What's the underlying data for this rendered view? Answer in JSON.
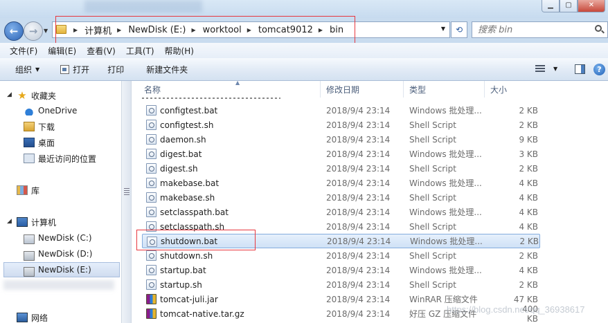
{
  "window": {
    "minimize_label": "▁",
    "maximize_label": "▢",
    "close_label": "✕"
  },
  "address": {
    "crumbs": [
      "计算机",
      "NewDisk (E:)",
      "worktool",
      "tomcat9012",
      "bin"
    ]
  },
  "search": {
    "placeholder": "搜索 bin"
  },
  "menu": [
    "文件(F)",
    "编辑(E)",
    "查看(V)",
    "工具(T)",
    "帮助(H)"
  ],
  "toolbar": {
    "organize": "组织",
    "open": "打开",
    "print": "打印",
    "new_folder": "新建文件夹"
  },
  "nav": {
    "favorites": "收藏夹",
    "onedrive": "OneDrive",
    "downloads": "下载",
    "desktop": "桌面",
    "recent": "最近访问的位置",
    "library": "库",
    "computer": "计算机",
    "drive_c": "NewDisk (C:)",
    "drive_d": "NewDisk (D:)",
    "drive_e": "NewDisk (E:)",
    "network": "网络"
  },
  "columns": {
    "name": "名称",
    "modified": "修改日期",
    "type": "类型",
    "size": "大小"
  },
  "files": [
    {
      "name": "configtest.bat",
      "date": "2018/9/4 23:14",
      "type": "Windows 批处理...",
      "size": "2 KB",
      "icon": "script-icon"
    },
    {
      "name": "configtest.sh",
      "date": "2018/9/4 23:14",
      "type": "Shell Script",
      "size": "2 KB",
      "icon": "script-icon"
    },
    {
      "name": "daemon.sh",
      "date": "2018/9/4 23:14",
      "type": "Shell Script",
      "size": "9 KB",
      "icon": "script-icon"
    },
    {
      "name": "digest.bat",
      "date": "2018/9/4 23:14",
      "type": "Windows 批处理...",
      "size": "3 KB",
      "icon": "script-icon"
    },
    {
      "name": "digest.sh",
      "date": "2018/9/4 23:14",
      "type": "Shell Script",
      "size": "2 KB",
      "icon": "script-icon"
    },
    {
      "name": "makebase.bat",
      "date": "2018/9/4 23:14",
      "type": "Windows 批处理...",
      "size": "4 KB",
      "icon": "script-icon"
    },
    {
      "name": "makebase.sh",
      "date": "2018/9/4 23:14",
      "type": "Shell Script",
      "size": "4 KB",
      "icon": "script-icon"
    },
    {
      "name": "setclasspath.bat",
      "date": "2018/9/4 23:14",
      "type": "Windows 批处理...",
      "size": "4 KB",
      "icon": "script-icon"
    },
    {
      "name": "setclasspath.sh",
      "date": "2018/9/4 23:14",
      "type": "Shell Script",
      "size": "4 KB",
      "icon": "script-icon"
    },
    {
      "name": "shutdown.bat",
      "date": "2018/9/4 23:14",
      "type": "Windows 批处理...",
      "size": "2 KB",
      "icon": "script-icon"
    },
    {
      "name": "shutdown.sh",
      "date": "2018/9/4 23:14",
      "type": "Shell Script",
      "size": "2 KB",
      "icon": "script-icon"
    },
    {
      "name": "startup.bat",
      "date": "2018/9/4 23:14",
      "type": "Windows 批处理...",
      "size": "4 KB",
      "icon": "script-icon"
    },
    {
      "name": "startup.sh",
      "date": "2018/9/4 23:14",
      "type": "Shell Script",
      "size": "2 KB",
      "icon": "script-icon"
    },
    {
      "name": "tomcat-juli.jar",
      "date": "2018/9/4 23:14",
      "type": "WinRAR 压缩文件",
      "size": "47 KB",
      "icon": "archive-icon"
    },
    {
      "name": "tomcat-native.tar.gz",
      "date": "2018/9/4 23:14",
      "type": "好压 GZ 压缩文件",
      "size": "400 KB",
      "icon": "archive-icon"
    }
  ],
  "selected_file_index": 9,
  "watermark": "https://blog.csdn.net/qq_36938617",
  "colors": {
    "highlight_box": "#e8373e",
    "selection": "#cfe1f6",
    "window_frame": "#c9dcef"
  }
}
